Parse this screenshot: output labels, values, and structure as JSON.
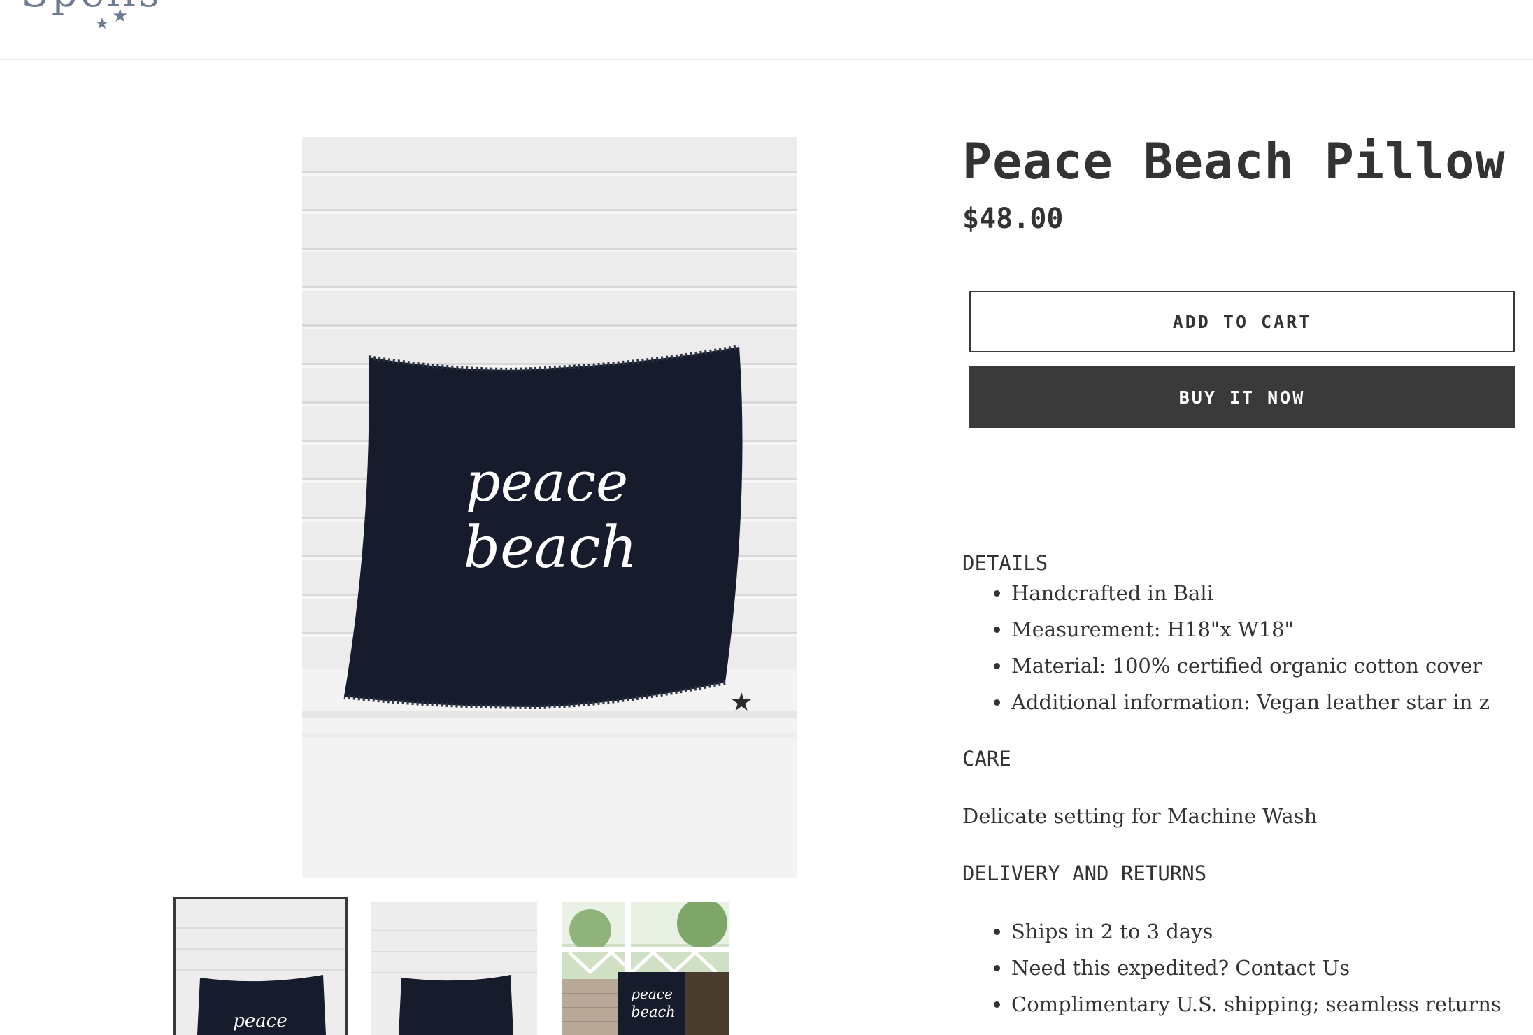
{
  "logo": {
    "text": "Spells",
    "star_icon": "star"
  },
  "product": {
    "title": "Peace Beach Pillow",
    "price": "$48.00",
    "add_to_cart": "ADD TO CART",
    "buy_now": "BUY IT NOW",
    "image_text_line1": "peace",
    "image_text_line2": "beach"
  },
  "thumbnails": [
    {
      "label": "peace",
      "label2": ""
    },
    {
      "label": "",
      "label2": ""
    },
    {
      "label": "peace",
      "label2": "beach"
    }
  ],
  "description": {
    "details_heading": "DETAILS",
    "details": [
      "Handcrafted in Bali",
      "Measurement: H18\"x W18\"",
      "Material: 100% certified organic cotton cover",
      "Additional information: Vegan leather star in z"
    ],
    "care_heading": "CARE",
    "care_text": "Delicate setting for Machine Wash",
    "delivery_heading": "DELIVERY AND RETURNS",
    "delivery": [
      "Ships in 2 to 3 days",
      "Need this expedited? Contact Us",
      "Complimentary U.S. shipping; seamless returns"
    ]
  },
  "colors": {
    "accent": "#3a3a3a",
    "pillow": "#161c2b",
    "logo": "#6d7c90"
  }
}
